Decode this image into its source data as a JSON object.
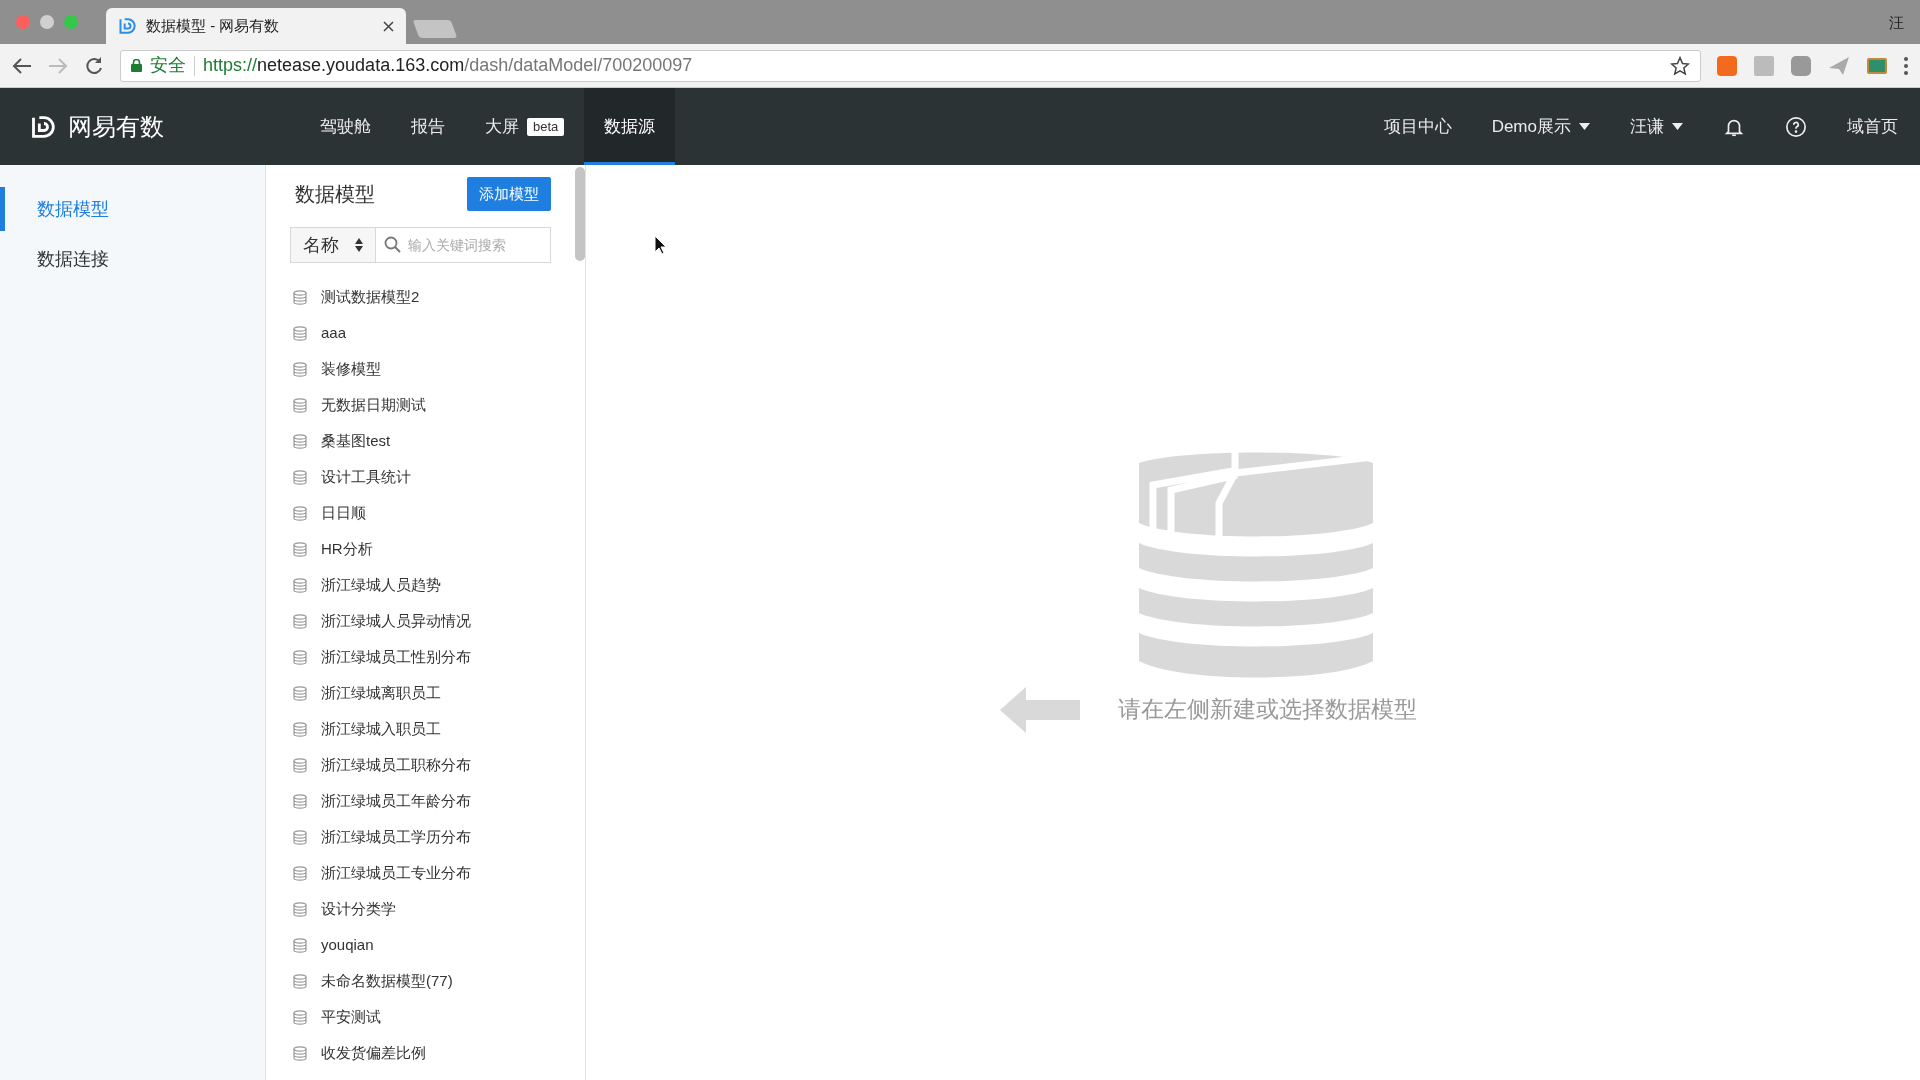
{
  "browser": {
    "tab_title": "数据模型 - 网易有数",
    "profile": "汪",
    "security_label": "安全",
    "url": {
      "scheme": "https://",
      "host": "netease.youdata.163.com",
      "path": "/dash/dataModel/700200097"
    }
  },
  "app": {
    "logo_text": "网易有数",
    "nav": [
      {
        "label": "驾驶舱",
        "selected": false
      },
      {
        "label": "报告",
        "selected": false
      },
      {
        "label": "大屏",
        "selected": false,
        "badge": "beta"
      },
      {
        "label": "数据源",
        "selected": true
      }
    ],
    "right_nav": [
      {
        "kind": "link",
        "label": "项目中心"
      },
      {
        "kind": "dropdown",
        "label": "Demo展示"
      },
      {
        "kind": "dropdown",
        "label": "汪谦"
      },
      {
        "kind": "bell"
      },
      {
        "kind": "help"
      },
      {
        "kind": "link",
        "label": "域首页"
      }
    ]
  },
  "sidebar": {
    "items": [
      {
        "label": "数据模型",
        "selected": true
      },
      {
        "label": "数据连接",
        "selected": false
      }
    ]
  },
  "model_list": {
    "title": "数据模型",
    "add_button": "添加模型",
    "filter_select": "名称",
    "search": {
      "placeholder": "输入关键词搜索"
    },
    "items": [
      {
        "name": "测试数据模型2"
      },
      {
        "name": "aaa"
      },
      {
        "name": "装修模型"
      },
      {
        "name": "无数据日期测试"
      },
      {
        "name": "桑基图test"
      },
      {
        "name": "设计工具统计"
      },
      {
        "name": "日日顺"
      },
      {
        "name": "HR分析"
      },
      {
        "name": "浙江绿城人员趋势"
      },
      {
        "name": "浙江绿城人员异动情况"
      },
      {
        "name": "浙江绿城员工性别分布"
      },
      {
        "name": "浙江绿城离职员工"
      },
      {
        "name": "浙江绿城入职员工"
      },
      {
        "name": "浙江绿城员工职称分布"
      },
      {
        "name": "浙江绿城员工年龄分布"
      },
      {
        "name": "浙江绿城员工学历分布"
      },
      {
        "name": "浙江绿城员工专业分布"
      },
      {
        "name": "设计分类学"
      },
      {
        "name": "youqian"
      },
      {
        "name": "未命名数据模型(77)"
      },
      {
        "name": "平安测试"
      },
      {
        "name": "收发货偏差比例"
      }
    ]
  },
  "empty_state": {
    "message": "请在左侧新建或选择数据模型"
  }
}
